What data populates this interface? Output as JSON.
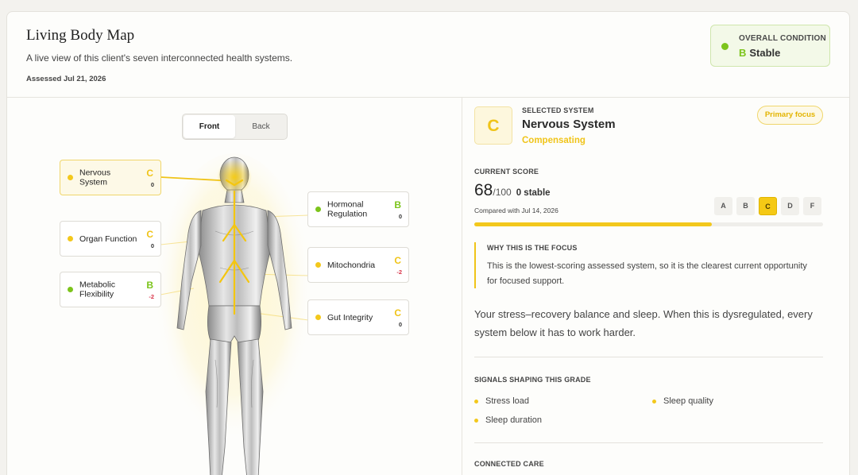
{
  "header": {
    "title": "Living Body Map",
    "subtitle": "A live view of this client's seven interconnected health systems.",
    "assessed": "Assessed Jul 21, 2026",
    "overall": {
      "label": "OVERALL CONDITION",
      "grade": "B",
      "status": "Stable",
      "color": "#7cc41c"
    }
  },
  "view_toggle": {
    "front": "Front",
    "back": "Back",
    "active": "Front"
  },
  "systems": [
    {
      "name": "Nervous System",
      "grade": "C",
      "delta": "0",
      "color": "#f3c81c",
      "selected": true
    },
    {
      "name": "Organ Function",
      "grade": "C",
      "delta": "0",
      "color": "#f3c81c"
    },
    {
      "name": "Metabolic Flexibility",
      "grade": "B",
      "delta": "-2",
      "color": "#7cc41c"
    },
    {
      "name": "Hormonal Regulation",
      "grade": "B",
      "delta": "0",
      "color": "#7cc41c"
    },
    {
      "name": "Mitochondria",
      "grade": "C",
      "delta": "-2",
      "color": "#f3c81c"
    },
    {
      "name": "Gut Integrity",
      "grade": "C",
      "delta": "0",
      "color": "#f3c81c"
    }
  ],
  "selected": {
    "icon_grade": "C",
    "label": "SELECTED SYSTEM",
    "name": "Nervous System",
    "status": "Compensating",
    "badge": "Primary focus",
    "score_label": "CURRENT SCORE",
    "score": "68",
    "score_max": "/100",
    "score_trend": "0 stable",
    "compared": "Compared with Jul 14, 2026",
    "score_fraction": 0.68,
    "grades": [
      "A",
      "B",
      "C",
      "D",
      "F"
    ],
    "active_grade": "C",
    "why_heading": "WHY THIS IS THE FOCUS",
    "why_text": "This is the lowest-scoring assessed system, so it is the clearest current opportunity for focused support.",
    "description": "Your stress–recovery balance and sleep. When this is dysregulated, every system below it has to work harder.",
    "signals_heading": "SIGNALS SHAPING THIS GRADE",
    "signals": [
      "Stress load",
      "Sleep quality",
      "Sleep duration"
    ],
    "connected_heading": "CONNECTED CARE"
  }
}
